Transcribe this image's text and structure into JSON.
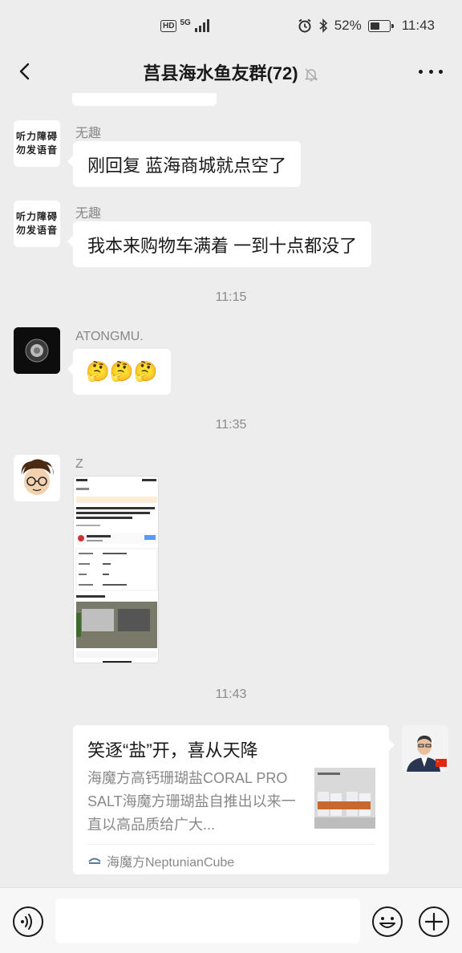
{
  "status_bar": {
    "network_badge": "HD",
    "network_type": "5G",
    "battery_percent": "52%",
    "battery_level": 0.52,
    "time": "11:43"
  },
  "header": {
    "title": "莒县海水鱼友群(72)"
  },
  "messages": [
    {
      "sender": "无趣",
      "avatar_text": [
        "听力障碍",
        "勿发语音"
      ],
      "text": "刚回复 蓝海商城就点空了"
    },
    {
      "sender": "无趣",
      "avatar_text": [
        "听力障碍",
        "勿发语音"
      ],
      "text": "我本来购物车满着 一到十点都没了"
    },
    {
      "time": "11:15"
    },
    {
      "sender": "ATONGMU.",
      "text": "🤔🤔🤔"
    },
    {
      "time": "11:35"
    },
    {
      "sender": "Z",
      "image": "screenshot of a marketplace listing"
    },
    {
      "time": "11:43"
    }
  ],
  "link_card": {
    "title": "笑逐“盐”开，喜从天降",
    "description": "海魔方高钙珊瑚盐CORAL PRO SALT海魔方珊瑚盐自推出以来一直以高品质给广大...",
    "source": "海魔方NeptunianCube"
  },
  "colors": {
    "background": "#ededed",
    "bubble": "#ffffff",
    "meta_text": "#888888"
  },
  "icons": {
    "back": "chevron-left-icon",
    "mute": "bell-off-icon",
    "more": "ellipsis-icon",
    "voice": "voice-icon",
    "emoji": "smiley-icon",
    "plus": "plus-icon"
  }
}
